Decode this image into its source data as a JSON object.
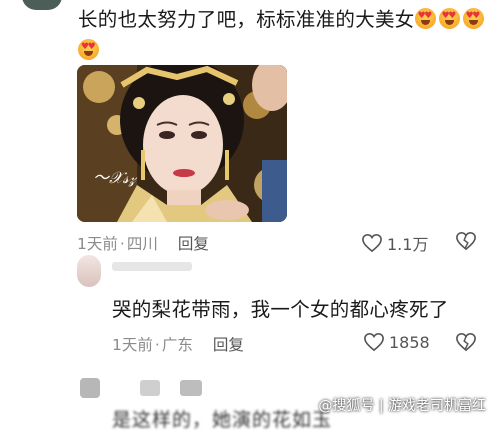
{
  "comment1": {
    "text": "长的也太努力了吧，标标准准的大美女",
    "emoji_icon": "heart-eyes-emoji",
    "date": "1天前",
    "location": "四川",
    "reply_label": "回复",
    "likes": "1.1万"
  },
  "comment2": {
    "text": "哭的梨花带雨，我一个女的都心疼死了",
    "date": "1天前",
    "location": "广东",
    "reply_label": "回复",
    "likes": "1858"
  },
  "comment3": {
    "partial_text": "是这样的，她演的花如玉"
  },
  "watermark": "@搜狐号 | 游戏老司机富红",
  "colors": {
    "meta_gray": "#8c8c8c",
    "icon_gray": "#555555"
  }
}
